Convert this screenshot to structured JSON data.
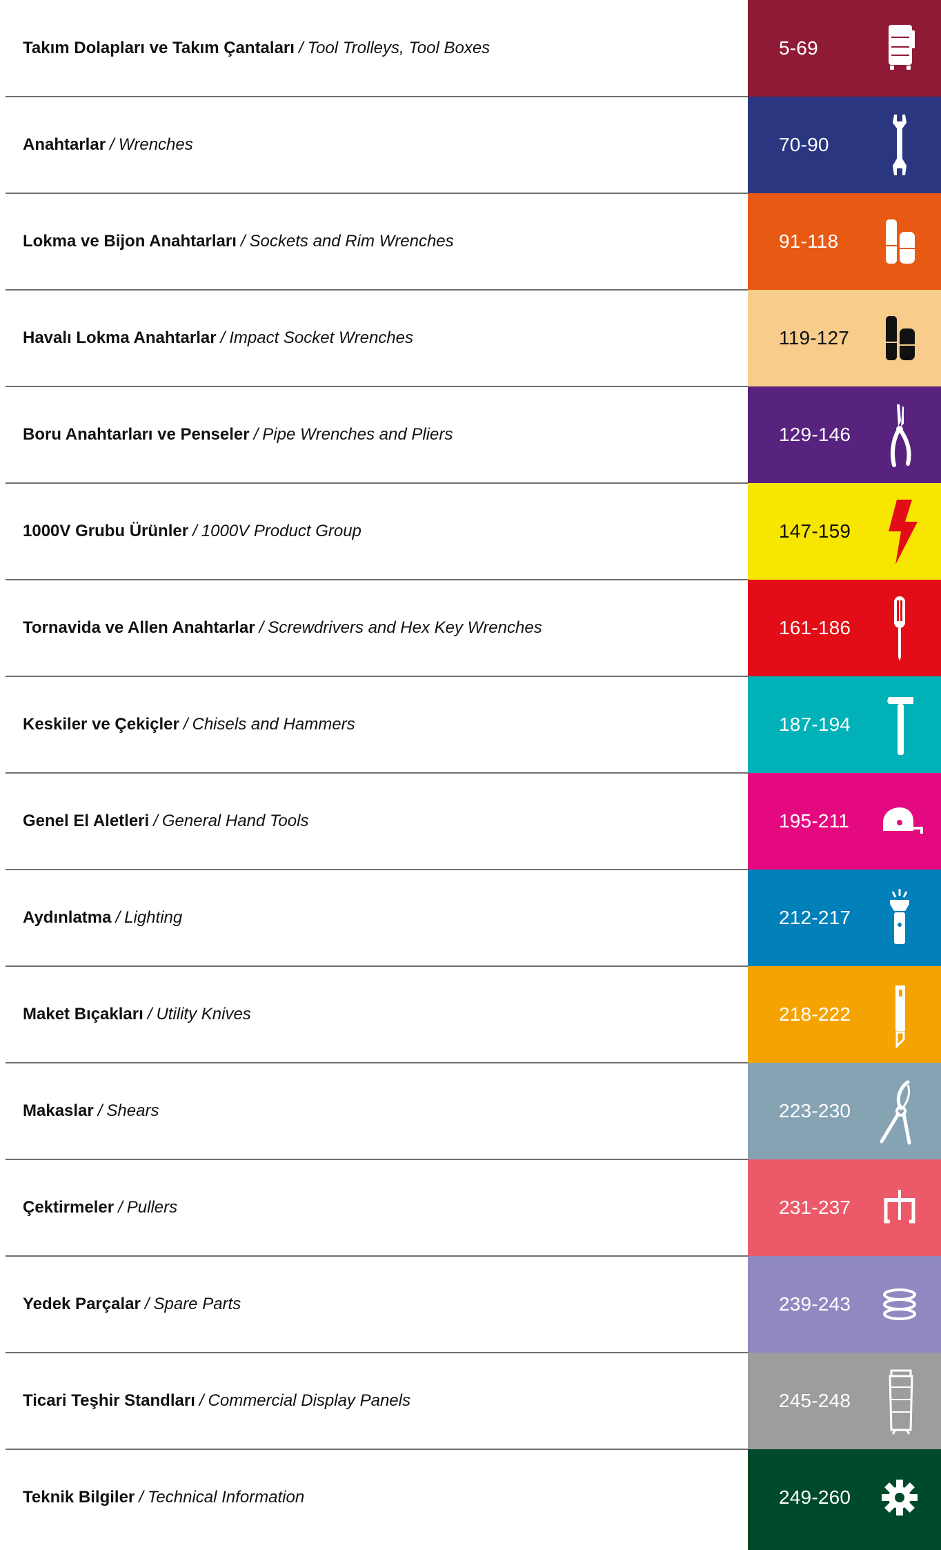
{
  "rows": [
    {
      "tr": "Takım Dolapları ve Takım Çantaları",
      "en": "Tool Trolleys, Tool Boxes",
      "pages": "5-69",
      "color": "#8f1a36",
      "text_color": "#ffffff",
      "icon": "tool-trolley-icon"
    },
    {
      "tr": "Anahtarlar",
      "en": "Wrenches",
      "pages": "70-90",
      "color": "#2a3680",
      "text_color": "#ffffff",
      "icon": "wrench-icon"
    },
    {
      "tr": "Lokma ve Bijon Anahtarları",
      "en": "Sockets and Rim Wrenches",
      "pages": "91-118",
      "color": "#e85a14",
      "text_color": "#ffffff",
      "icon": "sockets-icon"
    },
    {
      "tr": "Havalı Lokma Anahtarlar",
      "en": "Impact Socket Wrenches",
      "pages": "119-127",
      "color": "#f8cd8c",
      "text_color": "#111111",
      "icon": "impact-sockets-icon"
    },
    {
      "tr": "Boru Anahtarları ve Penseler",
      "en": "Pipe Wrenches and Pliers",
      "pages": "129-146",
      "color": "#58237f",
      "text_color": "#ffffff",
      "icon": "pliers-icon"
    },
    {
      "tr": "1000V Grubu Ürünler",
      "en": "1000V Product Group",
      "pages": "147-159",
      "color": "#f6e600",
      "text_color": "#111111",
      "icon": "lightning-bolt-icon"
    },
    {
      "tr": "Tornavida ve Allen Anahtarlar",
      "en": "Screwdrivers and Hex Key Wrenches",
      "pages": "161-186",
      "color": "#e20d16",
      "text_color": "#ffffff",
      "icon": "screwdriver-icon"
    },
    {
      "tr": "Keskiler ve Çekiçler",
      "en": "Chisels and Hammers",
      "pages": "187-194",
      "color": "#00b1b7",
      "text_color": "#ffffff",
      "icon": "hammer-icon"
    },
    {
      "tr": "Genel El Aletleri",
      "en": "General Hand Tools",
      "pages": "195-211",
      "color": "#e5097f",
      "text_color": "#ffffff",
      "icon": "tape-measure-icon"
    },
    {
      "tr": "Aydınlatma",
      "en": "Lighting",
      "pages": "212-217",
      "color": "#0180b9",
      "text_color": "#ffffff",
      "icon": "flashlight-icon"
    },
    {
      "tr": "Maket Bıçakları",
      "en": "Utility Knives",
      "pages": "218-222",
      "color": "#f5a300",
      "text_color": "#ffffff",
      "icon": "utility-knife-icon"
    },
    {
      "tr": "Makaslar",
      "en": "Shears",
      "pages": "223-230",
      "color": "#86a3b4",
      "text_color": "#ffffff",
      "icon": "shears-icon"
    },
    {
      "tr": "Çektirmeler",
      "en": "Pullers",
      "pages": "231-237",
      "color": "#ec5a69",
      "text_color": "#ffffff",
      "icon": "puller-icon"
    },
    {
      "tr": "Yedek Parçalar",
      "en": "Spare Parts",
      "pages": "239-243",
      "color": "#8f88c1",
      "text_color": "#ffffff",
      "icon": "spring-icon"
    },
    {
      "tr": "Ticari Teşhir Standları",
      "en": "Commercial Display Panels",
      "pages": "245-248",
      "color": "#9d9d9c",
      "text_color": "#ffffff",
      "icon": "display-stand-icon"
    },
    {
      "tr": "Teknik Bilgiler",
      "en": "Technical Information",
      "pages": "249-260",
      "color": "#004a2c",
      "text_color": "#ffffff",
      "icon": "gear-icon"
    }
  ]
}
